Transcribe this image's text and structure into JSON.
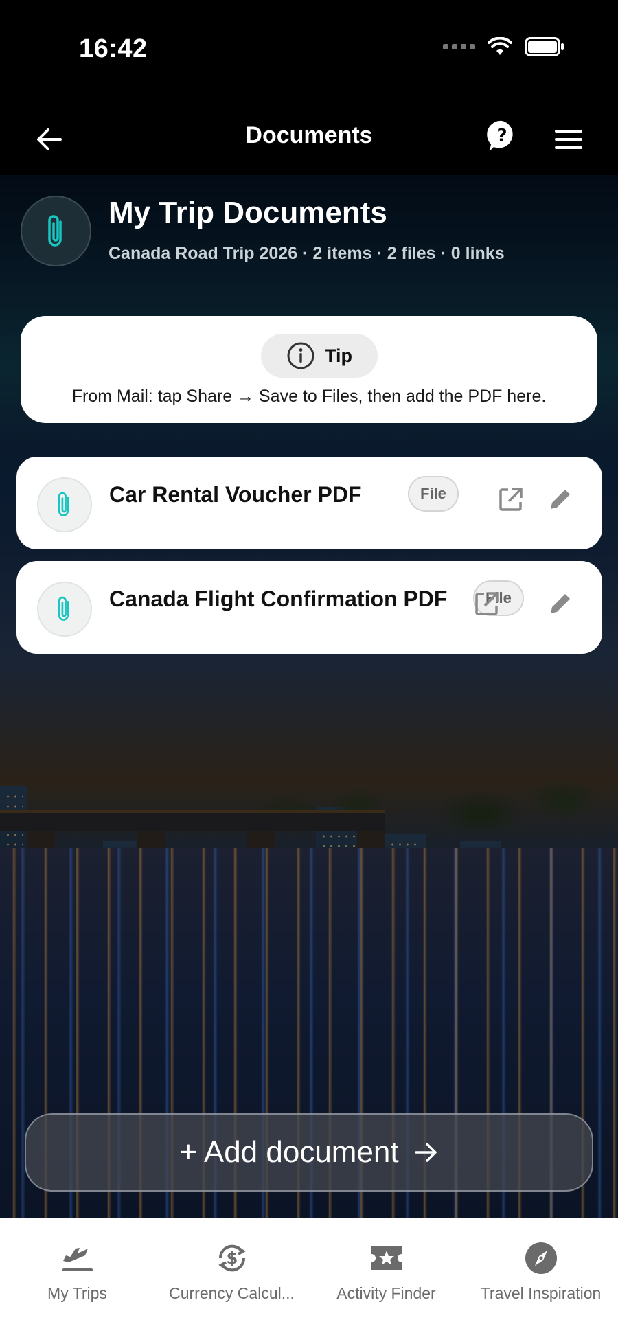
{
  "status_bar": {
    "time": "16:42"
  },
  "nav": {
    "title": "Documents"
  },
  "header": {
    "title": "My Trip Documents",
    "subtitle": "Canada Road Trip 2026 · 2 items · 2 files · 0 links"
  },
  "tip": {
    "label": "Tip",
    "text": "From Mail: tap Share → Save to Files, then add the PDF here."
  },
  "documents": [
    {
      "name": "Car Rental Voucher PDF",
      "badge": "File"
    },
    {
      "name": "Canada Flight Confirmation PDF",
      "badge": "File"
    }
  ],
  "add_button": {
    "label": "+ Add document"
  },
  "tabs": [
    {
      "label": "My Trips",
      "icon": "plane-icon"
    },
    {
      "label": "Currency Calcul...",
      "icon": "currency-exchange-icon"
    },
    {
      "label": "Activity Finder",
      "icon": "ticket-star-icon"
    },
    {
      "label": "Travel Inspiration",
      "icon": "compass-icon"
    }
  ],
  "colors": {
    "accent_teal": "#18c5c0",
    "tab_gray": "#6b6b6b",
    "card_bg": "#ffffff"
  }
}
